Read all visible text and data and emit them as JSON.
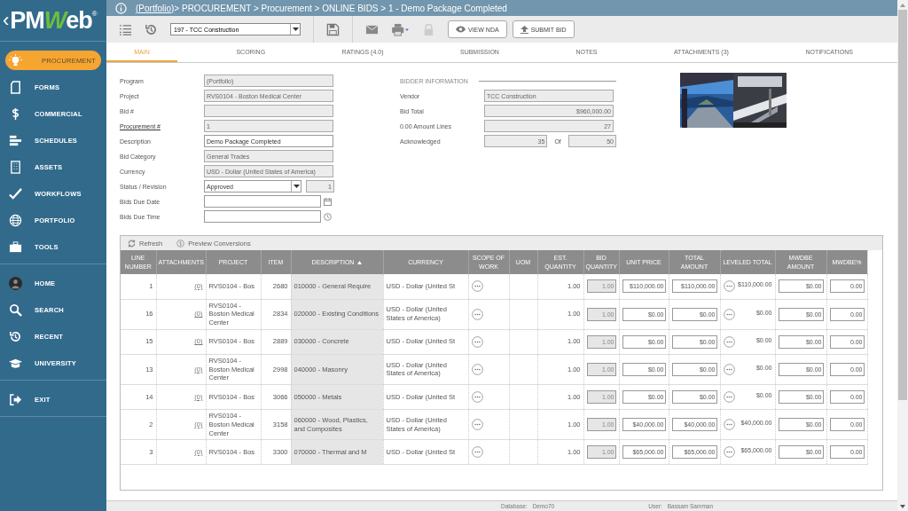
{
  "logo": {
    "back": "‹",
    "parts": [
      {
        "text": "PM",
        "accent": false
      },
      {
        "text": "W",
        "accent": true
      },
      {
        "text": "eb",
        "accent": false
      }
    ],
    "mark": "®"
  },
  "sidebar": {
    "groups": [
      [
        {
          "label": "PROCUREMENT",
          "selected": true
        },
        {
          "label": "FORMS",
          "selected": false
        },
        {
          "label": "COMMERCIAL",
          "selected": false
        },
        {
          "label": "SCHEDULES",
          "selected": false
        },
        {
          "label": "ASSETS",
          "selected": false
        },
        {
          "label": "WORKFLOWS",
          "selected": false
        },
        {
          "label": "PORTFOLIO",
          "selected": false
        },
        {
          "label": "TOOLS",
          "selected": false
        }
      ],
      [
        {
          "label": "HOME",
          "selected": false
        },
        {
          "label": "SEARCH",
          "selected": false
        },
        {
          "label": "RECENT",
          "selected": false
        },
        {
          "label": "UNIVERSITY",
          "selected": false
        }
      ],
      [
        {
          "label": "EXIT",
          "selected": false
        }
      ]
    ]
  },
  "breadcrumb": {
    "link": "(Portfolio)",
    "rest": " > PROCUREMENT > Procurement > ONLINE BIDS > 1 - Demo Package Completed"
  },
  "toolbar": {
    "record": "197 - TCC Construction",
    "buttons": [
      {
        "label": "VIEW NDA"
      },
      {
        "label": "SUBMIT BID"
      }
    ]
  },
  "tabs": [
    {
      "label": "MAIN",
      "selected": true
    },
    {
      "label": "SCORING",
      "selected": false
    },
    {
      "label": "RATINGS (4.0)",
      "selected": false
    },
    {
      "label": "SUBMISSION",
      "selected": false
    },
    {
      "label": "NOTES",
      "selected": false
    },
    {
      "label": "ATTACHMENTS (3)",
      "selected": false
    },
    {
      "label": "NOTIFICATIONS",
      "selected": false
    }
  ],
  "fields": [
    {
      "label": "Program",
      "kind": "readonly",
      "value": "(Portfolio)",
      "link": false
    },
    {
      "label": "Project",
      "kind": "readonly",
      "value": "RVS0104 - Boston Medical Center",
      "link": false
    },
    {
      "label": "Bid #",
      "kind": "readonly",
      "link": false
    },
    {
      "label": "Procurement #",
      "kind": "readonly",
      "value": "1",
      "link": true
    },
    {
      "label": "Description",
      "kind": "text",
      "value": "Demo Package Completed",
      "link": false
    },
    {
      "label": "Bid Category",
      "kind": "readonly",
      "value": "General Trades",
      "link": false
    },
    {
      "label": "Currency",
      "kind": "readonly",
      "value": "USD - Dollar (United States of America)",
      "link": false
    },
    {
      "label": "Status / Revision",
      "kind": "select",
      "value": "Approved",
      "revision": "1",
      "link": false
    },
    {
      "label": "Bids Due Date",
      "kind": "date",
      "link": false
    },
    {
      "label": "Bids Due Time",
      "kind": "time",
      "link": false
    }
  ],
  "bidder": {
    "heading": "BIDDER INFORMATION",
    "fields": [
      {
        "label": "Vendor",
        "kind": "text",
        "value": "TCC Construction"
      },
      {
        "label": "Bid Total",
        "kind": "number",
        "value": "$960,000.00"
      },
      {
        "label": "0.00 Amount Lines",
        "kind": "number",
        "value": "27"
      },
      {
        "label": "Acknowledged",
        "kind": "ratio",
        "value": "35",
        "of": "Of",
        "total": "50"
      }
    ]
  },
  "grid": {
    "actions": [
      {
        "label": "Refresh"
      },
      {
        "label": "Preview Conversions"
      }
    ],
    "columns": [
      {
        "label": "LINE NUMBER",
        "sorted": false
      },
      {
        "label": "ATTACHMENTS",
        "sorted": false
      },
      {
        "label": "PROJECT",
        "sorted": false
      },
      {
        "label": "ITEM",
        "sorted": false
      },
      {
        "label": "DESCRIPTION",
        "sorted": true
      },
      {
        "label": "CURRENCY",
        "sorted": false
      },
      {
        "label": "SCOPE OF WORK",
        "sorted": false
      },
      {
        "label": "UOM",
        "sorted": false
      },
      {
        "label": "EST. QUANTITY",
        "sorted": false
      },
      {
        "label": "BID QUANTITY",
        "sorted": false
      },
      {
        "label": "UNIT PRICE",
        "sorted": false
      },
      {
        "label": "TOTAL AMOUNT",
        "sorted": false
      },
      {
        "label": "LEVELED TOTAL",
        "sorted": false
      },
      {
        "label": "MWDBE AMOUNT",
        "sorted": false
      },
      {
        "label": "MWDBE%",
        "sorted": false
      }
    ],
    "rows": [
      {
        "line": "1",
        "attachments": "(0)",
        "project": "RVS0104 - Bos",
        "item": "2680",
        "description": "010000 - General Require",
        "currency": "USD - Dollar (United St",
        "est": "1.00",
        "bid": "1.00",
        "unit": "$110,000.00",
        "total": "$110,000.00",
        "leveled": "$110,000.00",
        "mwdbe": "$0.00",
        "pct": "0.00"
      },
      {
        "line": "16",
        "attachments": "(0)",
        "project": "RVS0104 - Boston Medical Center",
        "item": "2834",
        "description": "020000 - Existing Conditions",
        "currency": "USD - Dollar (United States of America)",
        "est": "1.00",
        "bid": "1.00",
        "unit": "$0.00",
        "total": "$0.00",
        "leveled": "$0.00",
        "mwdbe": "$0.00",
        "pct": "0.00"
      },
      {
        "line": "15",
        "attachments": "(0)",
        "project": "RVS0104 - Bos",
        "item": "2889",
        "description": "030000 - Concrete",
        "currency": "USD - Dollar (United St",
        "est": "1.00",
        "bid": "1.00",
        "unit": "$0.00",
        "total": "$0.00",
        "leveled": "$0.00",
        "mwdbe": "$0.00",
        "pct": "0.00"
      },
      {
        "line": "13",
        "attachments": "(0)",
        "project": "RVS0104 - Boston Medical Center",
        "item": "2998",
        "description": "040000 - Masonry",
        "currency": "USD - Dollar (United States of America)",
        "est": "1.00",
        "bid": "1.00",
        "unit": "$0.00",
        "total": "$0.00",
        "leveled": "$0.00",
        "mwdbe": "$0.00",
        "pct": "0.00"
      },
      {
        "line": "14",
        "attachments": "(0)",
        "project": "RVS0104 - Bos",
        "item": "3066",
        "description": "050000 - Metals",
        "currency": "USD - Dollar (United St",
        "est": "1.00",
        "bid": "1.00",
        "unit": "$0.00",
        "total": "$0.00",
        "leveled": "$0.00",
        "mwdbe": "$0.00",
        "pct": "0.00"
      },
      {
        "line": "2",
        "attachments": "(0)",
        "project": "RVS0104 - Boston Medical Center",
        "item": "3158",
        "description": "060000 - Wood, Plastics, and Composites",
        "currency": "USD - Dollar (United States of America)",
        "est": "1.00",
        "bid": "1.00",
        "unit": "$40,000.00",
        "total": "$40,000.00",
        "leveled": "$40,000.00",
        "mwdbe": "$0.00",
        "pct": "0.00"
      },
      {
        "line": "3",
        "attachments": "(0)",
        "project": "RVS0104 - Bos",
        "item": "3300",
        "description": "070000 - Thermal and M",
        "currency": "USD - Dollar (United St",
        "est": "1.00",
        "bid": "1.00",
        "unit": "$65,000.00",
        "total": "$65,000.00",
        "leveled": "$65,000.00",
        "mwdbe": "$0.00",
        "pct": "0.00"
      }
    ]
  },
  "status_bar": {
    "database_label": "Database:",
    "database": "Demo70",
    "user_label": "User:",
    "user": "Bassam Samman"
  }
}
